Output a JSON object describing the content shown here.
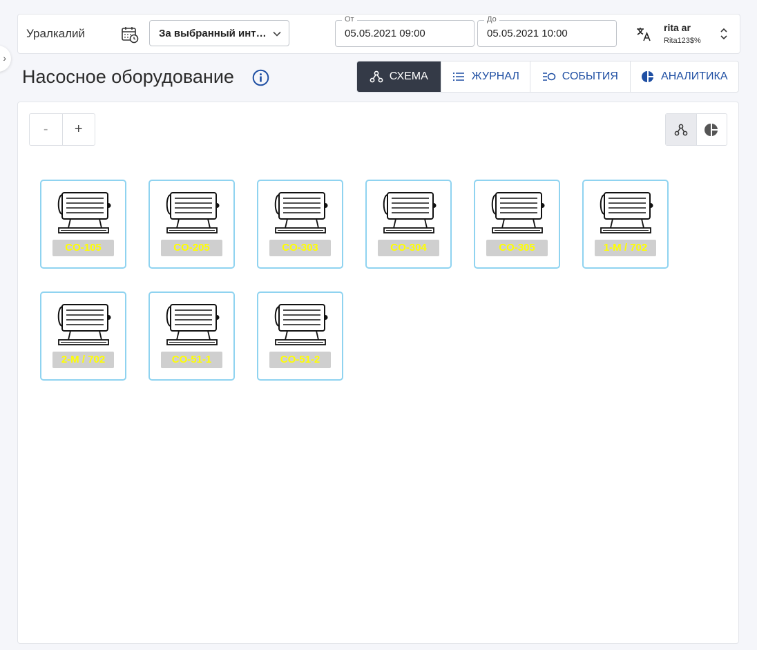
{
  "header": {
    "company": "Уралкалий",
    "period_select": "За выбранный интервал",
    "date_from": {
      "label": "От",
      "value": "05.05.2021 09:00"
    },
    "date_to": {
      "label": "До",
      "value": "05.05.2021 10:00"
    },
    "user": {
      "name": "rita ar",
      "login": "Rita123$%"
    }
  },
  "page": {
    "title": "Насосное оборудование"
  },
  "tabs": [
    {
      "label": "СХЕМА",
      "icon": "schema-icon",
      "active": true
    },
    {
      "label": "ЖУРНАЛ",
      "icon": "list-icon",
      "active": false
    },
    {
      "label": "СОБЫТИЯ",
      "icon": "events-icon",
      "active": false
    },
    {
      "label": "АНАЛИТИКА",
      "icon": "pie-chart-icon",
      "active": false
    }
  ],
  "zoom": {
    "minus_label": "-",
    "plus_label": "+"
  },
  "equipment": [
    {
      "label": "CO-105"
    },
    {
      "label": "CO-205"
    },
    {
      "label": "CO-303"
    },
    {
      "label": "CO-304"
    },
    {
      "label": "CO-305"
    },
    {
      "label": "1-M / 702"
    },
    {
      "label": "2-M / 702"
    },
    {
      "label": "CO-51-1"
    },
    {
      "label": "CO-51-2"
    }
  ],
  "colors": {
    "active_tab": "#343a47",
    "accent": "#1f4fa3",
    "card_border": "#8fd3f0",
    "tag_text": "#ffff00",
    "tag_bg": "#cfcfcf"
  }
}
